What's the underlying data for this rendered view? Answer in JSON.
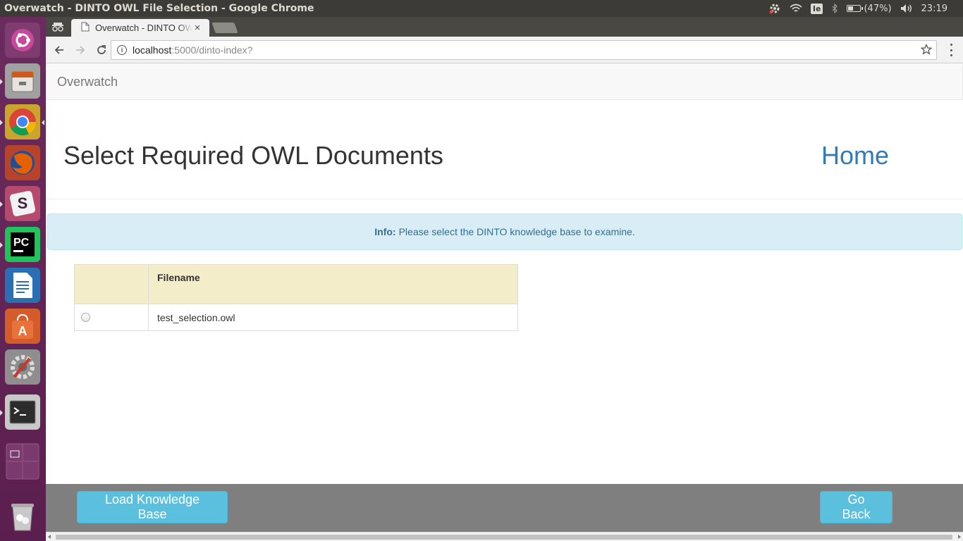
{
  "os": {
    "window_title": "Overwatch - DINTO OWL File Selection - Google Chrome",
    "keyboard_layout": "Ie",
    "battery_text": "(47%)",
    "battery_level": 0.47,
    "clock": "23:19",
    "launcher_items": [
      "ubuntu-dash-icon",
      "files-icon",
      "chrome-icon",
      "firefox-icon",
      "slack-icon",
      "pycharm-icon",
      "writer-icon",
      "software-center-icon",
      "system-settings-icon",
      "terminal-icon",
      "workspaces-icon",
      "trash-icon"
    ]
  },
  "browser": {
    "tab_title": "Overwatch - DINTO OWL File Selection",
    "url_host": "localhost",
    "url_path": ":5000/dinto-index?"
  },
  "page": {
    "brand": "Overwatch",
    "heading": "Select Required OWL Documents",
    "home_link": "Home",
    "alert_label": "Info:",
    "alert_text": "Please select the DINTO knowledge base to examine.",
    "table": {
      "columns": [
        "",
        "Filename"
      ],
      "rows": [
        {
          "selected": false,
          "filename": "test_selection.owl"
        }
      ]
    },
    "load_button": "Load Knowledge Base",
    "back_button": "Go Back"
  },
  "colors": {
    "alert_bg": "#d9edf7",
    "table_header_bg": "#f4edc9",
    "button_info": "#5bc0de",
    "link": "#337ab7",
    "footer_bg": "#7f7f7f"
  }
}
